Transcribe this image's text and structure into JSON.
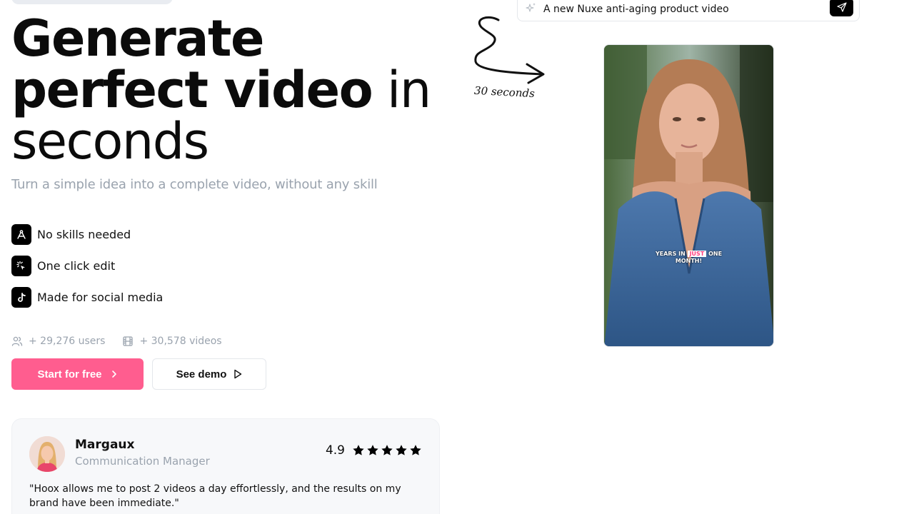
{
  "hero": {
    "title_bold_1": "Generate",
    "title_bold_2": "perfect video",
    "title_normal_1": " in",
    "title_normal_2": "seconds",
    "subtitle": "Turn a simple idea into a complete video, without any skill"
  },
  "features": [
    {
      "label": "No skills needed",
      "icon": "compass-icon"
    },
    {
      "label": "One click edit",
      "icon": "click-icon"
    },
    {
      "label": "Made for social media",
      "icon": "tiktok-icon"
    }
  ],
  "stats": {
    "users": "+ 29,276 users",
    "videos": "+ 30,578 videos"
  },
  "buttons": {
    "primary": "Start for free",
    "secondary": "See demo"
  },
  "testimonial": {
    "name": "Margaux",
    "role": "Communication Manager",
    "rating": "4.9",
    "stars": 5,
    "quote": "\"Hoox allows me to post 2 videos a day effortlessly, and the results on my brand have been immediate.\""
  },
  "prompt": {
    "text": "A new Nuxe anti-aging product video"
  },
  "doodle": {
    "label": "30 seconds"
  },
  "video": {
    "caption_pre": "YEARS IN ",
    "caption_highlight": "JUST",
    "caption_post": " ONE",
    "caption_line2": "MONTH!"
  },
  "colors": {
    "accent": "#ff5d8f",
    "muted": "#9aa3ae",
    "dark": "#000000"
  }
}
